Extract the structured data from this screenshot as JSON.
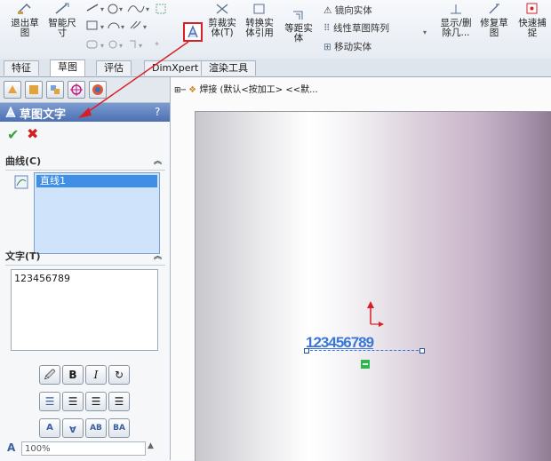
{
  "ribbon": {
    "exit_sketch": "退出草\n图",
    "smart_dim": "智能尺\n寸",
    "trim": "剪裁实\n体(T)",
    "convert": "转换实\n体引用",
    "offset": "等距实\n体",
    "mirror": "镜向实体",
    "linear_pattern": "线性草图阵列",
    "move": "移动实体",
    "show_delete": "显示/删\n除几...",
    "repair": "修复草\n图",
    "quick_snap": "快速捕\n捉"
  },
  "tabs": [
    "特征",
    "草图",
    "评估",
    "DimXpert",
    "渲染工具"
  ],
  "active_tab": "草图",
  "tree": {
    "label": "焊接  (默认<按加工> <<默..."
  },
  "property_manager": {
    "title": "草图文字",
    "help": "?",
    "curves_group": "曲线(C)",
    "curve_item": "直线1",
    "text_group": "文字(T)",
    "text_value": "123456789",
    "width_value": "100%"
  },
  "format_buttons": {
    "bold": "B",
    "italic": "I"
  },
  "canvas": {
    "sketch_text": "123456789"
  },
  "colors": {
    "accent": "#4a6fb5",
    "highlight": "#d91f26"
  }
}
